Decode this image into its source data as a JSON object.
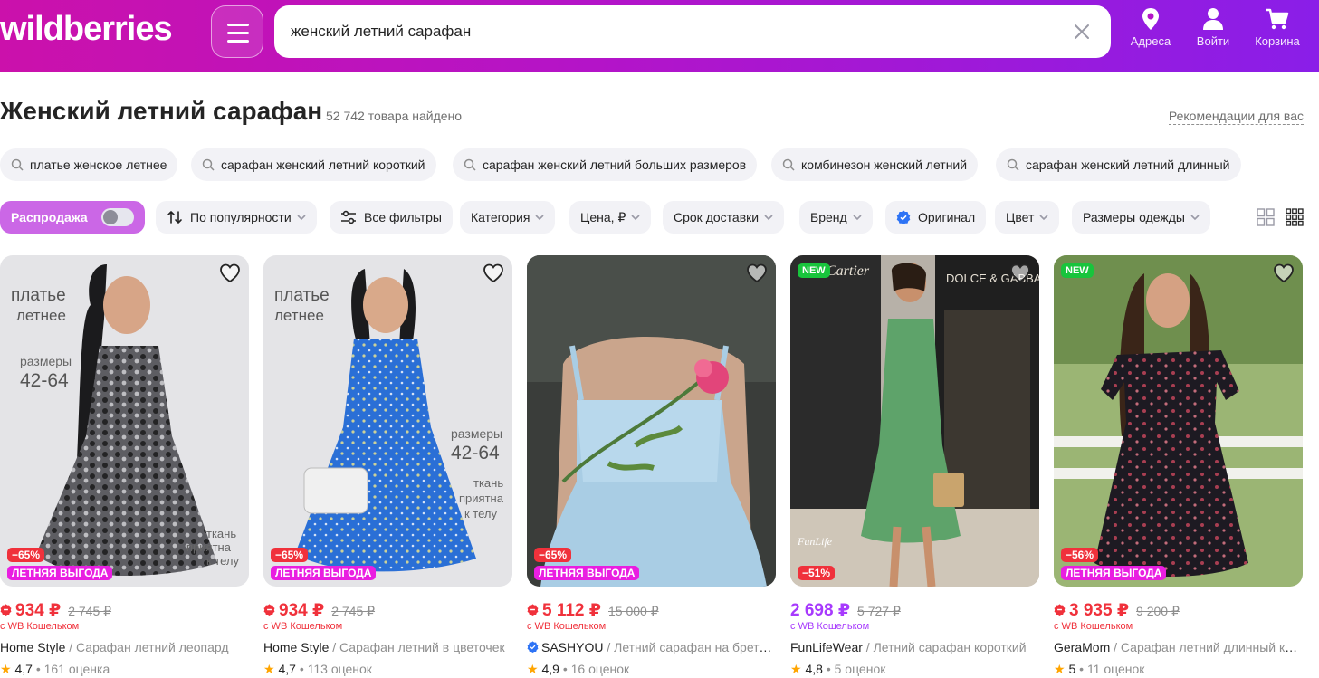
{
  "header": {
    "logo": "wildberries",
    "search_value": "женский летний сарафан",
    "addresses_label": "Адреса",
    "login_label": "Войти",
    "cart_label": "Корзина"
  },
  "page": {
    "title": "Женский летний сарафан",
    "count": "52 742 товара найдено",
    "recommendations": "Рекомендации для вас"
  },
  "suggestions": [
    "платье женское летнее",
    "сарафан женский летний короткий",
    "сарафан женский летний больших размеров",
    "комбинезон женский летний",
    "сарафан женский летний длинный"
  ],
  "filters": {
    "sale": "Распродажа",
    "sort": "По популярности",
    "all_filters": "Все фильтры",
    "category": "Категория",
    "price": "Цена, ₽",
    "delivery": "Срок доставки",
    "brand": "Бренд",
    "original": "Оригинал",
    "color": "Цвет",
    "sizes": "Размеры одежды"
  },
  "colors": {
    "accent_red": "#f0313b",
    "accent_violet": "#a73afd",
    "header_start": "#cb11ab",
    "header_end": "#8a1ee8"
  },
  "products": [
    {
      "price": "934 ₽",
      "old_price": "2 745 ₽",
      "wallet": "с WB Кошельком",
      "brand": "Home Style",
      "desc": " / Сарафан летний леопард",
      "rating": "4,7",
      "reviews": "161 оценка",
      "discount": "−65%",
      "promo": "ЛЕТНЯЯ ВЫГОДА",
      "img_text": [
        "платье",
        "летнее",
        "размеры",
        "42-64",
        "ткань",
        "приятна",
        "к телу"
      ]
    },
    {
      "price": "934 ₽",
      "old_price": "2 745 ₽",
      "wallet": "с WB Кошельком",
      "brand": "Home Style",
      "desc": " / Сарафан летний в цветочек",
      "rating": "4,7",
      "reviews": "113 оценок",
      "discount": "−65%",
      "promo": "ЛЕТНЯЯ ВЫГОДА",
      "img_text": [
        "платье",
        "летнее",
        "размеры",
        "42-64",
        "ткань",
        "приятна",
        "к телу"
      ]
    },
    {
      "price": "5 112 ₽",
      "old_price": "15 000 ₽",
      "wallet": "с WB Кошельком",
      "brand": "SASHYOU",
      "desc": " / Летний сарафан на бретелях",
      "rating": "4,9",
      "reviews": "16 оценок",
      "discount": "−65%",
      "promo": "ЛЕТНЯЯ ВЫГОДА"
    },
    {
      "price": "2 698 ₽",
      "old_price": "5 727 ₽",
      "wallet": "с WB Кошельком",
      "brand": "FunLifeWear",
      "desc": " / Летний сарафан короткий",
      "rating": "4,8",
      "reviews": "5 оценок",
      "discount": "−51%",
      "new_badge": "NEW",
      "img_text": [
        "Cartier",
        "DOLCE & GABBANA",
        "FunLife"
      ]
    },
    {
      "price": "3 935 ₽",
      "old_price": "9 200 ₽",
      "wallet": "с WB Кошельком",
      "brand": "GeraMom",
      "desc": " / Сарафан летний длинный крестьянка",
      "rating": "5",
      "reviews": "11 оценок",
      "discount": "−56%",
      "promo": "ЛЕТНЯЯ ВЫГОДА",
      "new_badge": "NEW"
    }
  ]
}
